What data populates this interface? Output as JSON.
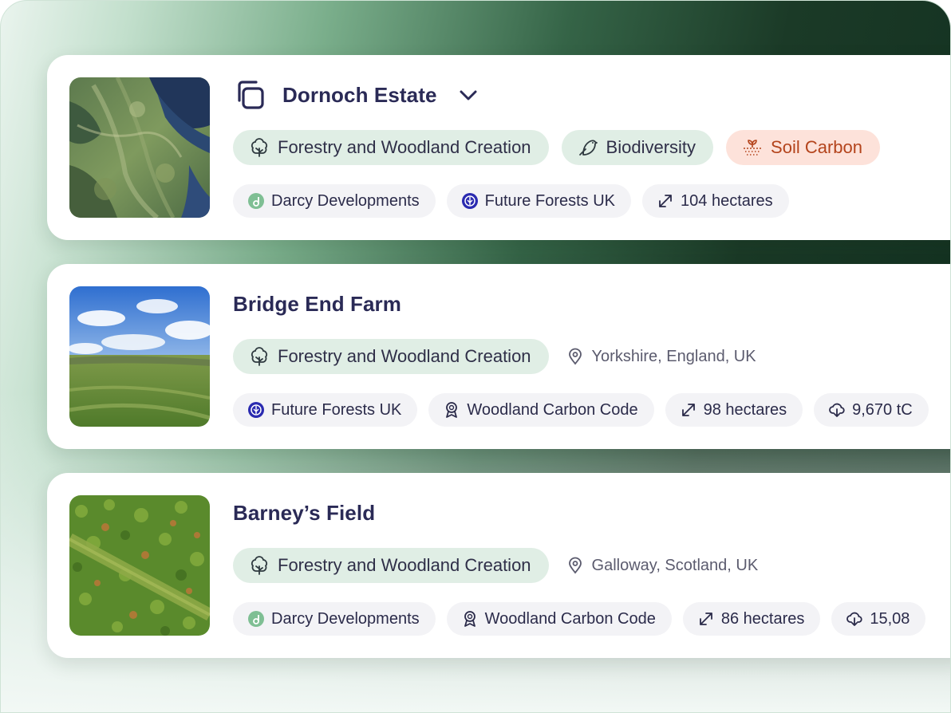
{
  "projects": [
    {
      "title": "Dornoch Estate",
      "categories": [
        {
          "label": "Forestry and Woodland Creation",
          "icon": "tree-icon"
        },
        {
          "label": "Biodiversity",
          "icon": "bird-icon"
        },
        {
          "label": "Soil Carbon",
          "icon": "soil-icon"
        }
      ],
      "tags": [
        {
          "label": "Darcy Developments",
          "icon": "darcy-logo-icon"
        },
        {
          "label": "Future Forests UK",
          "icon": "future-forests-logo-icon"
        },
        {
          "label": "104 hectares",
          "icon": "resize-arrows-icon"
        }
      ]
    },
    {
      "title": "Bridge End Farm",
      "categories": [
        {
          "label": "Forestry and Woodland Creation",
          "icon": "tree-icon"
        }
      ],
      "location": "Yorkshire, England, UK",
      "tags": [
        {
          "label": "Future Forests UK",
          "icon": "future-forests-logo-icon"
        },
        {
          "label": "Woodland Carbon Code",
          "icon": "award-icon"
        },
        {
          "label": "98 hectares",
          "icon": "resize-arrows-icon"
        },
        {
          "label": "9,670 tC",
          "icon": "cloud-download-icon"
        }
      ]
    },
    {
      "title": "Barney’s Field",
      "categories": [
        {
          "label": "Forestry and Woodland Creation",
          "icon": "tree-icon"
        }
      ],
      "location": "Galloway, Scotland, UK",
      "tags": [
        {
          "label": "Darcy Developments",
          "icon": "darcy-logo-icon"
        },
        {
          "label": "Woodland Carbon Code",
          "icon": "award-icon"
        },
        {
          "label": "86 hectares",
          "icon": "resize-arrows-icon"
        },
        {
          "label": "15,08",
          "icon": "cloud-download-icon"
        }
      ]
    }
  ],
  "colors": {
    "title": "#2a2a56",
    "category_pill": "#e0eee5",
    "soil_pill": "#fde2da",
    "soil_text": "#b4441c",
    "tag_pill": "#f3f3f6",
    "background_dark": "#123020"
  }
}
